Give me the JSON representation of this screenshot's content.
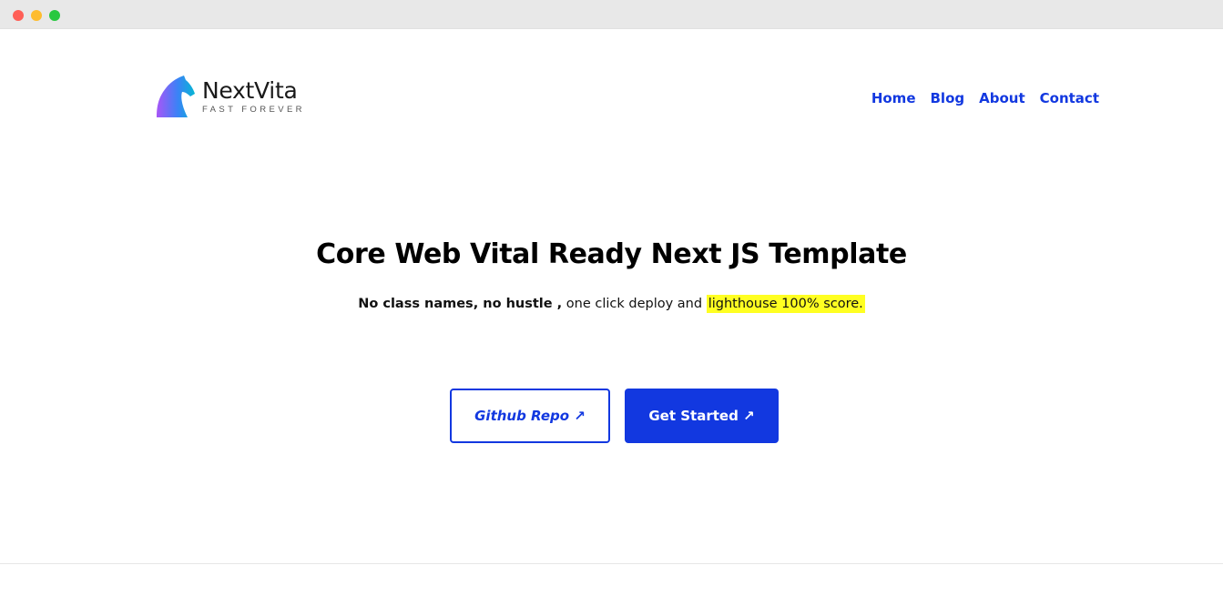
{
  "window": {
    "controls": [
      "close",
      "minimize",
      "maximize"
    ]
  },
  "brand": {
    "name": "NextVita",
    "tagline": "FAST FOREVER",
    "logo_icon": "horse-head-icon",
    "gradient": [
      "#a855f7",
      "#3b82f6",
      "#06b6d4"
    ]
  },
  "nav": {
    "items": [
      {
        "label": "Home"
      },
      {
        "label": "Blog"
      },
      {
        "label": "About"
      },
      {
        "label": "Contact"
      }
    ],
    "color": "#1238e0"
  },
  "hero": {
    "title": "Core Web Vital Ready Next JS Template",
    "subtitle_bold": "No class names, no hustle ,",
    "subtitle_plain": " one click deploy and ",
    "subtitle_highlight": "lighthouse 100% score.",
    "highlight_color": "#ffff22"
  },
  "buttons": {
    "github": "Github Repo ↗",
    "get_started": "Get Started ↗",
    "accent": "#1238e0"
  }
}
